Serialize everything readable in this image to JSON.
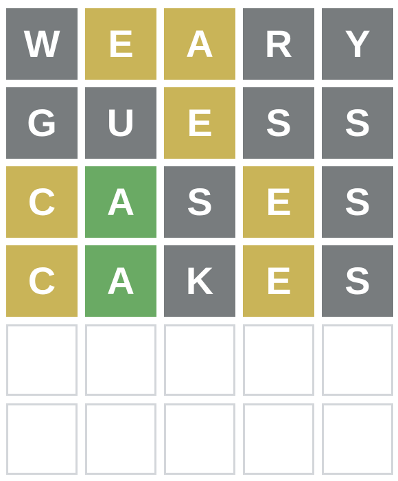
{
  "colors": {
    "absent": "#787c7e",
    "present": "#c9b458",
    "correct": "#6aaa64",
    "empty_border": "#d3d6da",
    "letter": "#ffffff"
  },
  "board": {
    "rows": [
      {
        "word": "WEARY",
        "tiles": [
          {
            "letter": "W",
            "state": "absent"
          },
          {
            "letter": "E",
            "state": "present"
          },
          {
            "letter": "A",
            "state": "present"
          },
          {
            "letter": "R",
            "state": "absent"
          },
          {
            "letter": "Y",
            "state": "absent"
          }
        ]
      },
      {
        "word": "GUESS",
        "tiles": [
          {
            "letter": "G",
            "state": "absent"
          },
          {
            "letter": "U",
            "state": "absent"
          },
          {
            "letter": "E",
            "state": "present"
          },
          {
            "letter": "S",
            "state": "absent"
          },
          {
            "letter": "S",
            "state": "absent"
          }
        ]
      },
      {
        "word": "CASES",
        "tiles": [
          {
            "letter": "C",
            "state": "present"
          },
          {
            "letter": "A",
            "state": "correct"
          },
          {
            "letter": "S",
            "state": "absent"
          },
          {
            "letter": "E",
            "state": "present"
          },
          {
            "letter": "S",
            "state": "absent"
          }
        ]
      },
      {
        "word": "CAKES",
        "tiles": [
          {
            "letter": "C",
            "state": "present"
          },
          {
            "letter": "A",
            "state": "correct"
          },
          {
            "letter": "K",
            "state": "absent"
          },
          {
            "letter": "E",
            "state": "present"
          },
          {
            "letter": "S",
            "state": "absent"
          }
        ]
      },
      {
        "word": "",
        "tiles": [
          {
            "letter": "",
            "state": "empty"
          },
          {
            "letter": "",
            "state": "empty"
          },
          {
            "letter": "",
            "state": "empty"
          },
          {
            "letter": "",
            "state": "empty"
          },
          {
            "letter": "",
            "state": "empty"
          }
        ]
      },
      {
        "word": "",
        "tiles": [
          {
            "letter": "",
            "state": "empty"
          },
          {
            "letter": "",
            "state": "empty"
          },
          {
            "letter": "",
            "state": "empty"
          },
          {
            "letter": "",
            "state": "empty"
          },
          {
            "letter": "",
            "state": "empty"
          }
        ]
      }
    ]
  }
}
